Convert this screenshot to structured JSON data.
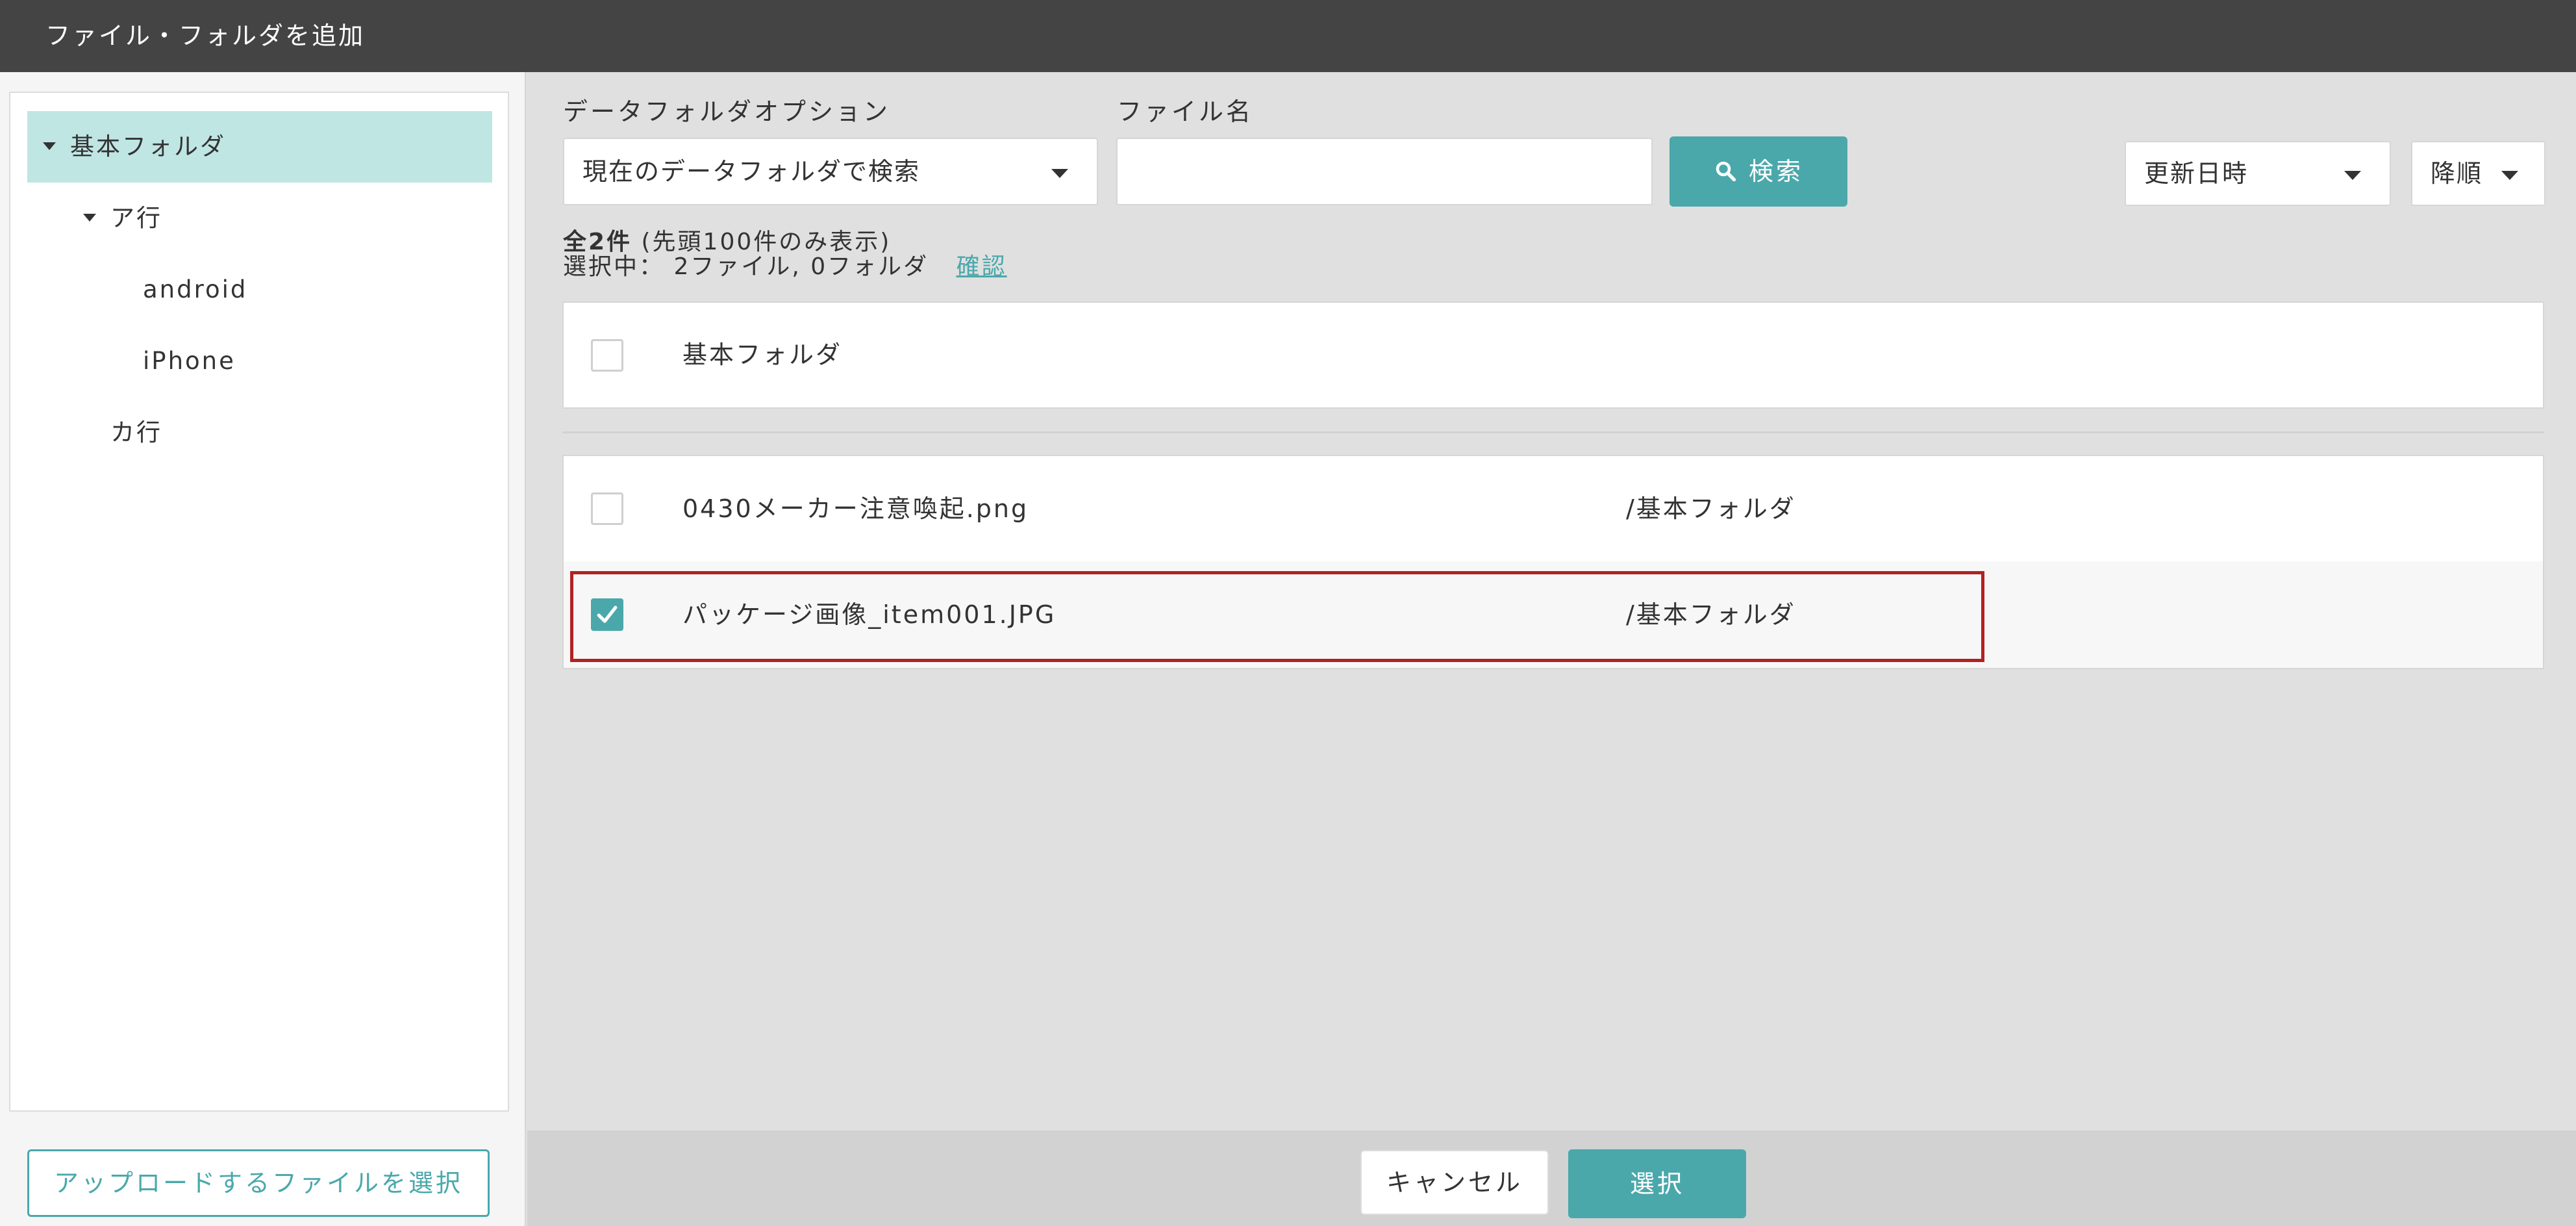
{
  "dialog": {
    "title": "ファイル・フォルダを追加"
  },
  "sidebar": {
    "tree": [
      {
        "label": "基本フォルダ",
        "expanded": true,
        "selected": true
      },
      {
        "label": "ア行",
        "expanded": true,
        "selected": false
      },
      {
        "label": "android",
        "selected": false
      },
      {
        "label": "iPhone",
        "selected": false
      },
      {
        "label": "カ行",
        "selected": false
      }
    ],
    "upload_label": "アップロードするファイルを選択"
  },
  "search": {
    "folder_option_label": "データフォルダオプション",
    "folder_option_value": "現在のデータフォルダで検索",
    "filename_label": "ファイル名",
    "filename_value": "",
    "search_button_label": "検索",
    "sort_field_value": "更新日時",
    "sort_order_value": "降順"
  },
  "results": {
    "total_label": "全2件",
    "total_note": "(先頭100件のみ表示)",
    "selected_summary": "選択中： 2ファイル, 0フォルダ",
    "confirm_link": "確認"
  },
  "folder_list": [
    {
      "name": "基本フォルダ",
      "checked": false
    }
  ],
  "file_list": [
    {
      "name": "0430メーカー注意喚起.png",
      "path": "/基本フォルダ",
      "checked": false
    },
    {
      "name": "パッケージ画像_item001.JPG",
      "path": "/基本フォルダ",
      "checked": true
    }
  ],
  "footer": {
    "cancel_label": "キャンセル",
    "select_label": "選択"
  },
  "colors": {
    "accent": "#4aa8ab",
    "title_bar": "#444444",
    "tree_selected": "#c0e6e4",
    "highlight_border": "#b22222"
  }
}
